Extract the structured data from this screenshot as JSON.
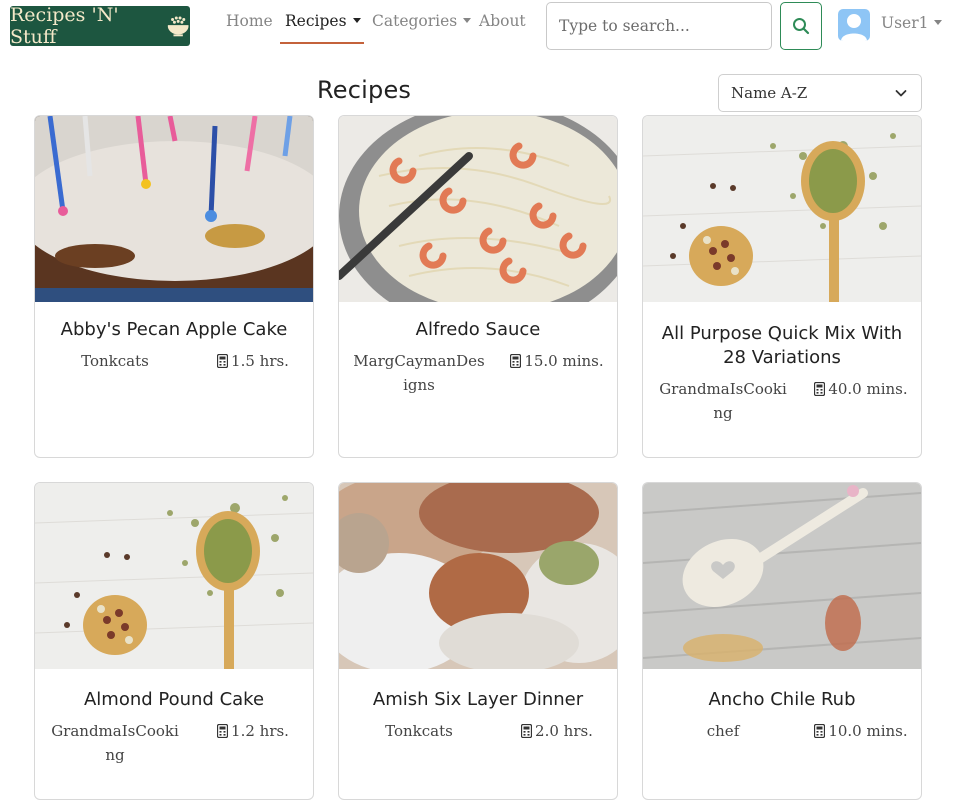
{
  "brand": {
    "name": "Recipes 'N' Stuff",
    "color": "#1d5640"
  },
  "nav": {
    "home": "Home",
    "recipes": "Recipes",
    "categories": "Categories",
    "about": "About"
  },
  "search": {
    "placeholder": "Type to search...",
    "value": ""
  },
  "user": {
    "name": "User1"
  },
  "page": {
    "title": "Recipes"
  },
  "sort": {
    "selected": "Name A-Z"
  },
  "recipes": [
    {
      "title": "Abby's Pecan Apple Cake",
      "author": "Tonkcats",
      "time": "1.5 hrs."
    },
    {
      "title": "Alfredo Sauce",
      "author": "MargCaymanDesigns",
      "time": "15.0 mins."
    },
    {
      "title": "All Purpose Quick Mix With 28 Variations",
      "author": "GrandmaIsCooking",
      "time": "40.0 mins."
    },
    {
      "title": "Almond Pound Cake",
      "author": "GrandmaIsCooking",
      "time": "1.2 hrs."
    },
    {
      "title": "Amish Six Layer Dinner",
      "author": "Tonkcats",
      "time": "2.0 hrs."
    },
    {
      "title": "Ancho Chile Rub",
      "author": "chef",
      "time": "10.0 mins."
    }
  ],
  "colors": {
    "accent": "#c4623b",
    "search_button": "#2e8b57"
  }
}
